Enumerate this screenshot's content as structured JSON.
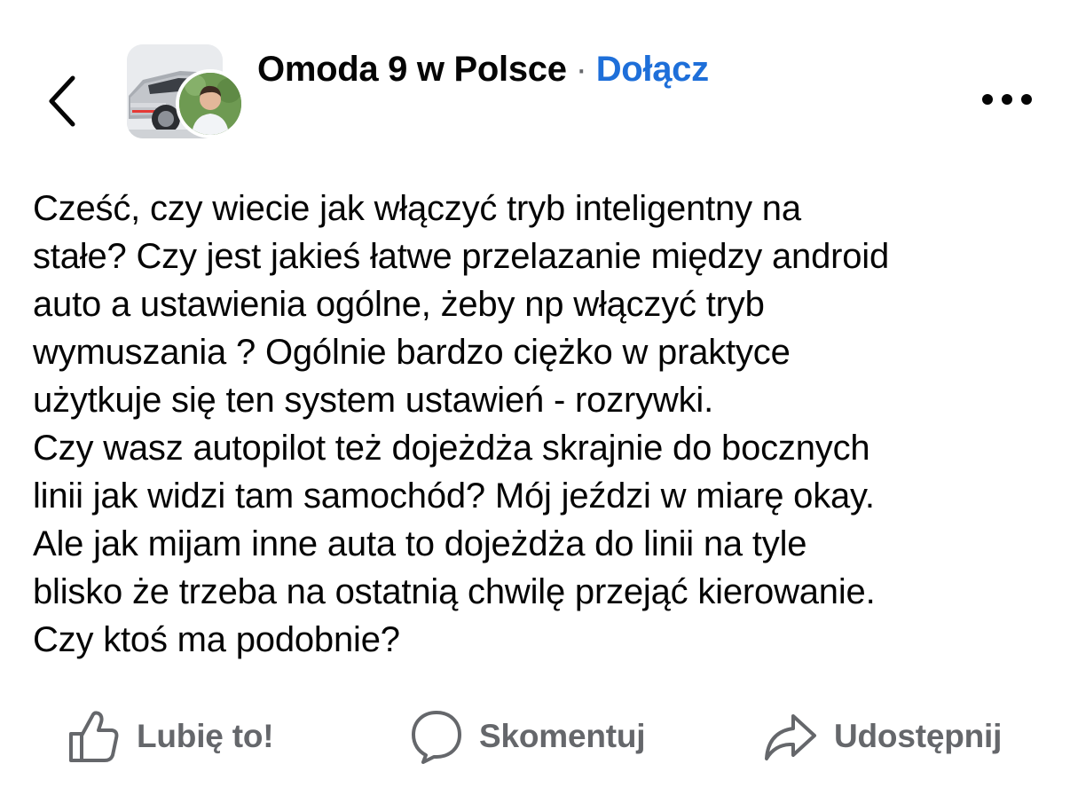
{
  "header": {
    "group_name": "Omoda 9 w Polsce",
    "separator": "·",
    "join_label": "Dołącz",
    "accent_color": "#1e6fd9"
  },
  "icons": {
    "back": "chevron-left-icon",
    "more": "more-horizontal-icon",
    "like": "thumbs-up-icon",
    "comment": "speech-bubble-icon",
    "share": "share-arrow-icon"
  },
  "post": {
    "lines": [
      "Cześć, czy wiecie jak włączyć tryb inteligentny na",
      "stałe? Czy jest jakieś łatwe przelazanie między android",
      "auto a ustawienia ogólne, żeby np włączyć tryb",
      "wymuszania ? Ogólnie bardzo ciężko w praktyce",
      "użytkuje się ten system ustawień - rozrywki.",
      "Czy wasz autopilot też dojeżdża skrajnie do bocznych",
      "linii jak widzi tam samochód? Mój jeździ w miarę okay.",
      "Ale jak mijam inne auta to dojeżdża do linii na tyle",
      "blisko że trzeba na ostatnią chwilę przejąć kierowanie.",
      "Czy ktoś ma podobnie?"
    ]
  },
  "actions": {
    "like_label": "Lubię to!",
    "comment_label": "Skomentuj",
    "share_label": "Udostępnij"
  }
}
